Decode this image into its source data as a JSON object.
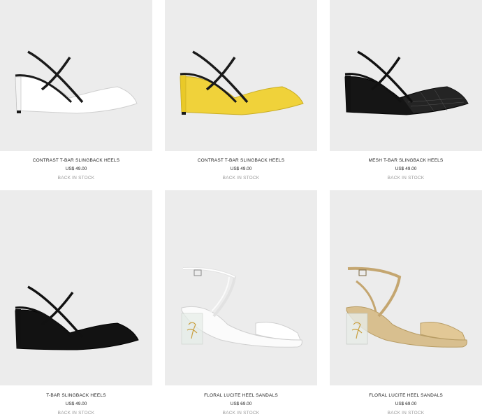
{
  "products": [
    {
      "name": "CONTRAST T-BAR SLINGBACK HEELS",
      "price": "US$ 49.00",
      "status": "BACK IN STOCK",
      "icon": "white-slingback-heel-image",
      "colors": {
        "upper": "#ffffff",
        "trim": "#1a1a1a",
        "heel": "#f4f4f4"
      }
    },
    {
      "name": "CONTRAST T-BAR SLINGBACK HEELS",
      "price": "US$ 49.00",
      "status": "BACK IN STOCK",
      "icon": "yellow-slingback-heel-image",
      "colors": {
        "upper": "#f0d23a",
        "trim": "#1a1a1a",
        "heel": "#f0d23a"
      }
    },
    {
      "name": "MESH T-BAR SLINGBACK HEELS",
      "price": "US$ 49.00",
      "status": "BACK IN STOCK",
      "icon": "black-mesh-slingback-heel-image",
      "colors": {
        "upper": "#151515",
        "trim": "#111111",
        "heel": "#111111"
      }
    },
    {
      "name": "T-BAR SLINGBACK HEELS",
      "price": "US$ 49.00",
      "status": "BACK IN STOCK",
      "icon": "black-slingback-heel-image",
      "colors": {
        "upper": "#121212",
        "trim": "#111111",
        "heel": "#111111"
      }
    },
    {
      "name": "FLORAL LUCITE HEEL SANDALS",
      "price": "US$ 69.00",
      "status": "BACK IN STOCK",
      "icon": "white-lucite-heel-sandal-image",
      "colors": {
        "upper": "#fbfbfb",
        "trim": "#dcdcdc",
        "heel": "#e6eee8"
      }
    },
    {
      "name": "FLORAL LUCITE HEEL SANDALS",
      "price": "US$ 69.00",
      "status": "BACK IN STOCK",
      "icon": "gold-lucite-heel-sandal-image",
      "colors": {
        "upper": "#d8bf8f",
        "trim": "#c4a670",
        "heel": "#e8ece8"
      }
    }
  ]
}
